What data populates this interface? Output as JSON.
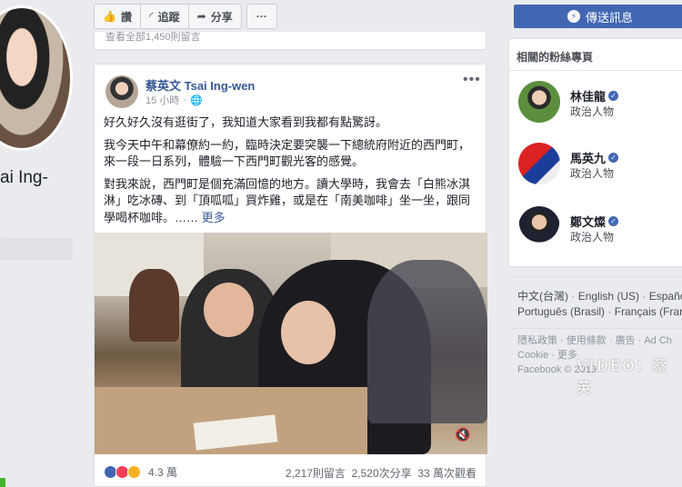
{
  "profile": {
    "name_partial": "ai Ing-"
  },
  "actions": {
    "like": "讚",
    "follow": "追蹤",
    "share": "分享",
    "more": "···"
  },
  "send_message": "傳送訊息",
  "previous_post": {
    "stats_partial": "查看全部1,450則留言"
  },
  "post": {
    "author": "蔡英文 Tsai Ing-wen",
    "time": "15 小時",
    "more": "•••",
    "paragraphs": [
      "好久好久沒有逛街了，我知道大家看到我都有點驚訝。",
      "我今天中午和幕僚約一約，臨時決定要突襲一下總統府附近的西門町，來一段一日系列，體驗一下西門町觀光客的感覺。",
      "對我來說，西門町是個充滿回憶的地方。讀大學時，我會去「白熊冰淇淋」吃冰磚、到「頂呱呱」買炸雞，或是在「南美咖啡」坐一坐，跟同學喝杯咖啡。……"
    ],
    "see_more": "更多",
    "reaction_count": "4.3 萬",
    "comments": "2,217則留言",
    "shares": "2,520次分享",
    "views": "33 萬次觀看"
  },
  "related": {
    "title": "相關的粉絲專頁",
    "pages": [
      {
        "name": "林佳龍",
        "category": "政治人物"
      },
      {
        "name": "馬英九",
        "category": "政治人物"
      },
      {
        "name": "鄭文燦",
        "category": "政治人物"
      }
    ]
  },
  "languages": {
    "items": [
      "中文(台灣)",
      "English (US)",
      "Españo",
      "Português (Brasil)",
      "Français (Fran"
    ]
  },
  "footer": {
    "links": [
      "隱私政策",
      "使用條款",
      "廣告",
      "Ad Ch",
      "Cookie",
      "更多"
    ],
    "copyright": "Facebook © 2019"
  },
  "watermark": "VIDEO：蔡英"
}
